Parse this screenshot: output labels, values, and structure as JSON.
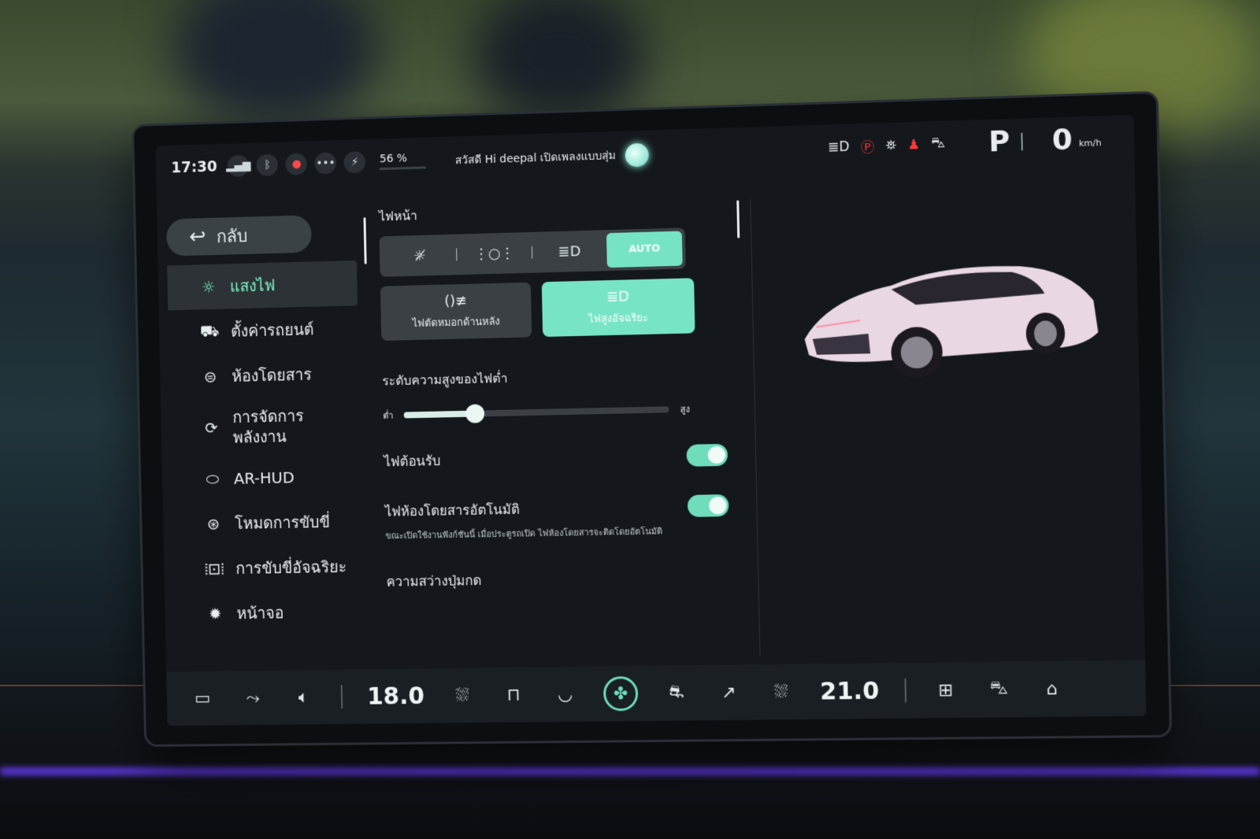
{
  "status": {
    "time": "17:30",
    "battery_percent": "56 %",
    "battery_level": 0.56,
    "voice_prompt": "สวัสดี Hi deepal เปิดเพลงแบบสุ่ม",
    "gear": "P",
    "speed": "0",
    "speed_unit": "km/h"
  },
  "sidebar": {
    "back_label": "กลับ",
    "items": [
      {
        "label": "แสงไฟ",
        "icon": "sun-icon"
      },
      {
        "label": "ตั้งค่ารถยนต์",
        "icon": "car-icon"
      },
      {
        "label": "ห้องโดยสาร",
        "icon": "cabin-icon"
      },
      {
        "label": "การจัดการ\nพลังงาน",
        "icon": "energy-icon"
      },
      {
        "label": "AR-HUD",
        "icon": "hud-icon"
      },
      {
        "label": "โหมดการขับขี่",
        "icon": "steering-wheel-icon"
      },
      {
        "label": "การขับขี่อัจฉริยะ",
        "icon": "smart-drive-icon"
      },
      {
        "label": "หน้าจอ",
        "icon": "brightness-icon"
      }
    ]
  },
  "lights": {
    "section_title": "ไฟหน้า",
    "auto_label": "AUTO",
    "rear_fog_label": "ไฟตัดหมอกด้านหลัง",
    "smart_high_label": "ไฟสูงอัจฉริยะ",
    "height_title": "ระดับความสูงของไฟต่ำ",
    "low_label": "ต่ำ",
    "high_label": "สูง",
    "height_level": 0.27,
    "welcome_label": "ไฟต้อนรับ",
    "auto_cabin_label": "ไฟห้องโดยสารอัตโนมัติ",
    "auto_cabin_desc": "ขณะเปิดใช้งานฟังก์ชันนี้ เมื่อประตูรถเปิด ไฟห้องโดยสารจะติดโดยอัตโนมัติ",
    "button_brightness_label": "ความสว่างปุ่มกด"
  },
  "dock": {
    "left_temp": "18.0",
    "right_temp": "21.0"
  },
  "colors": {
    "accent": "#76e4c4",
    "active_text": "#7ef3c4",
    "alert_red": "#ff3838"
  }
}
